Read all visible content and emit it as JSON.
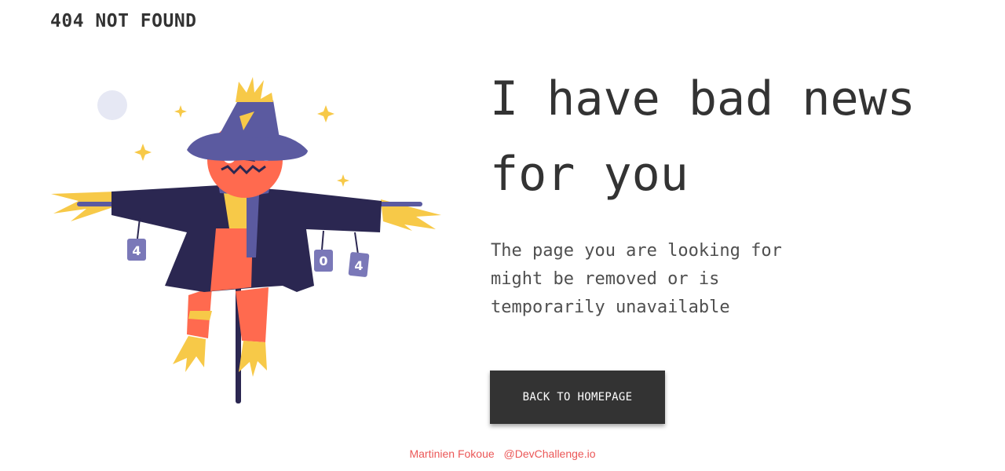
{
  "header": {
    "title": "404 NOT FOUND"
  },
  "main": {
    "headline": "I have bad news for you",
    "message": "The page you are looking for might be removed or is temporarily unavailable",
    "button_label": "BACK TO HOMEPAGE"
  },
  "illustration": {
    "subject": "scarecrow",
    "cans": [
      "4",
      "0",
      "4"
    ]
  },
  "footer": {
    "author": "Martinien Fokoue",
    "handle": "@DevChallenge.io"
  },
  "colors": {
    "text": "#333333",
    "button_bg": "#333333",
    "button_text": "#ffffff",
    "footer_text": "#eb5757",
    "hat": "#5b5aa0",
    "coat": "#2b2751",
    "face": "#ff6a4f",
    "straw": "#f7c948",
    "moon": "#e6e8f4"
  }
}
